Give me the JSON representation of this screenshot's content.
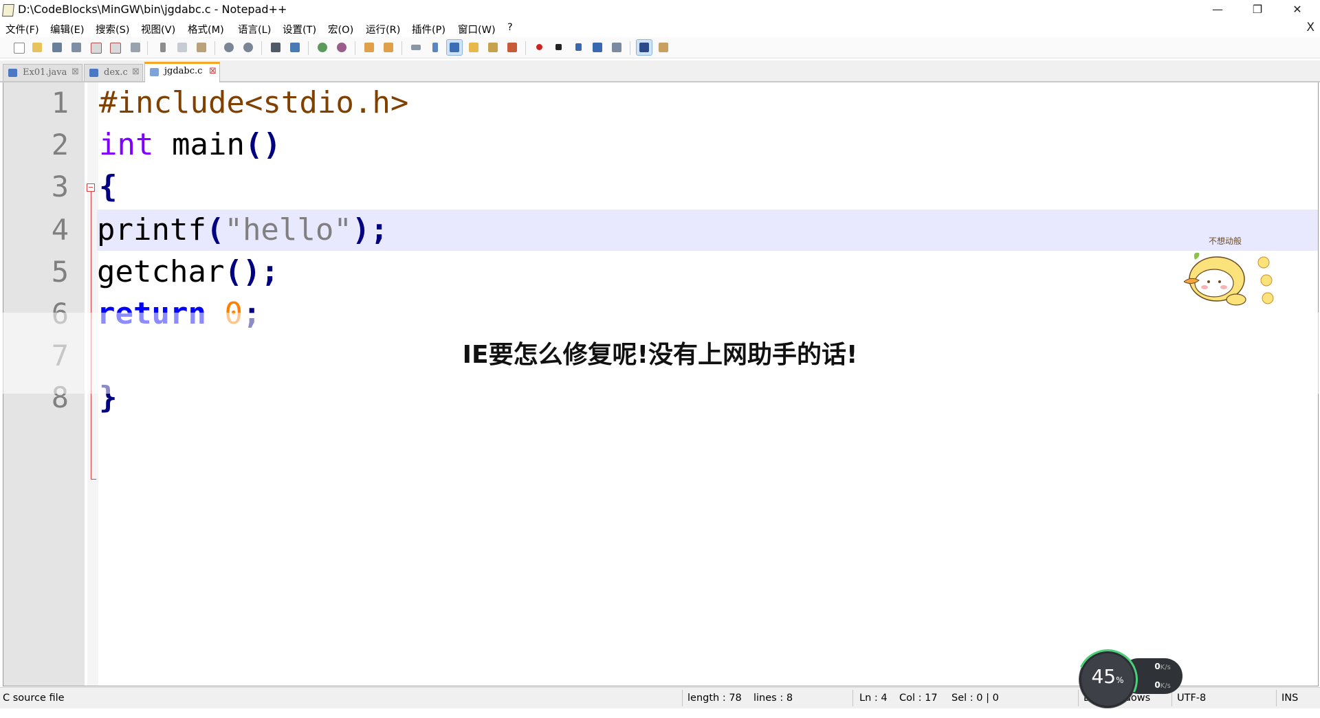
{
  "window": {
    "title": "D:\\CodeBlocks\\MinGW\\bin\\jgdabc.c - Notepad++",
    "minimize": "—",
    "maximize": "❐",
    "close": "✕"
  },
  "menu": {
    "items": [
      "文件(F)",
      "编辑(E)",
      "搜索(S)",
      "视图(V)",
      "格式(M)",
      "语言(L)",
      "设置(T)",
      "宏(O)",
      "运行(R)",
      "插件(P)",
      "窗口(W)",
      "?"
    ],
    "close_doc": "X"
  },
  "tabs": [
    {
      "label": "Ex01.java",
      "close": "⊠"
    },
    {
      "label": "dex.c",
      "close": "⊠"
    },
    {
      "label": "jgdabc.c",
      "close": "⊠"
    }
  ],
  "editor": {
    "line_numbers": [
      "1",
      "2",
      "3",
      "4",
      "5",
      "6",
      "7",
      "8"
    ],
    "current_line": 4,
    "code": {
      "l1": "#include<stdio.h>",
      "l2_kw": "int",
      "l2_name": " main",
      "l2_paren": "()",
      "l3": "{",
      "l4_fn": "printf",
      "l4_open": "(",
      "l4_str": "\"hello\"",
      "l4_close": ");",
      "l5_fn": "getchar",
      "l5_paren": "();",
      "l6_kw": "return",
      "l6_num": "0",
      "l6_semi": ";",
      "l8": "}"
    }
  },
  "overlay": {
    "caption": "IE要怎么修复呢!没有上网助手的话!",
    "sticker_text": "不想动般"
  },
  "status": {
    "file_type": "C source file",
    "length": "length : 78",
    "lines": "lines : 8",
    "ln": "Ln : 4",
    "col": "Col : 17",
    "sel": "Sel : 0 | 0",
    "eol": "Dos\\Windows",
    "encoding": "UTF-8",
    "mode": "INS"
  },
  "net_widget": {
    "percent": "45",
    "percent_unit": "%",
    "up": "0",
    "down": "0",
    "unit": "K/s"
  }
}
